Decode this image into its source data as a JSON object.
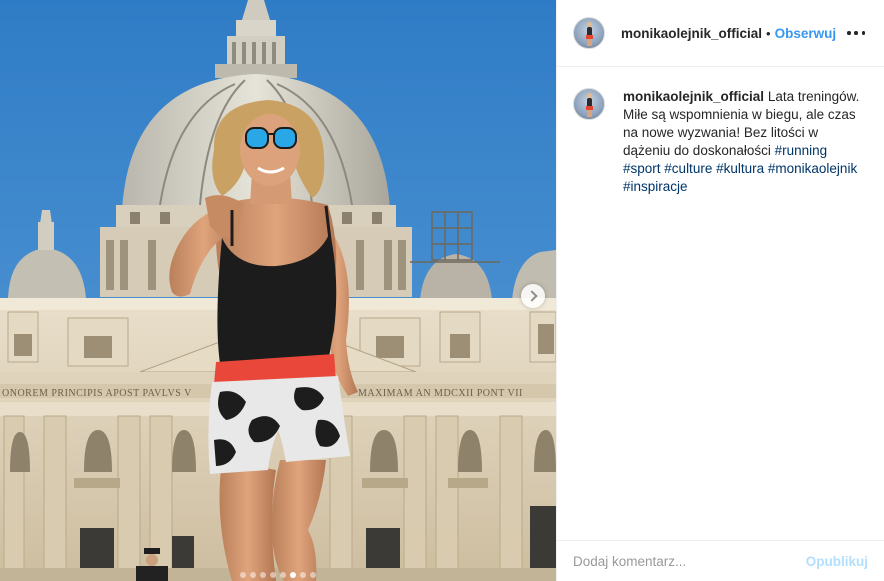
{
  "post": {
    "photo": {
      "alt": "Biegnąca kobieta przed Bazyliką św. Piotra",
      "facade_inscription_left": "ONOREM PRINCIPIS APOST PAVLVS V",
      "facade_inscription_right": "MAXIMAM AN MDCXII PONT VII",
      "carousel_slides": 8,
      "carousel_active_index": 5
    },
    "header": {
      "username": "monikaolejnik_official",
      "separator": "•",
      "follow_label": "Obserwuj",
      "more_icon": "more-horizontal-icon"
    },
    "caption": {
      "username": "monikaolejnik_official",
      "text": "Lata treningów. Miłe są wspomnienia w biegu, ale czas na nowe wyzwania! Bez litości w dążeniu do doskonałości",
      "hashtags": [
        "#running",
        "#sport",
        "#culture",
        "#kultura",
        "#monikaolejnik",
        "#inspiracje"
      ]
    },
    "comment": {
      "placeholder": "Dodaj komentarz...",
      "publish_label": "Opublikuj"
    }
  },
  "colors": {
    "link_blue": "#3897f0",
    "hashtag": "#003569",
    "publish_disabled": "#b2dffc",
    "sky": "#3b84c9"
  }
}
